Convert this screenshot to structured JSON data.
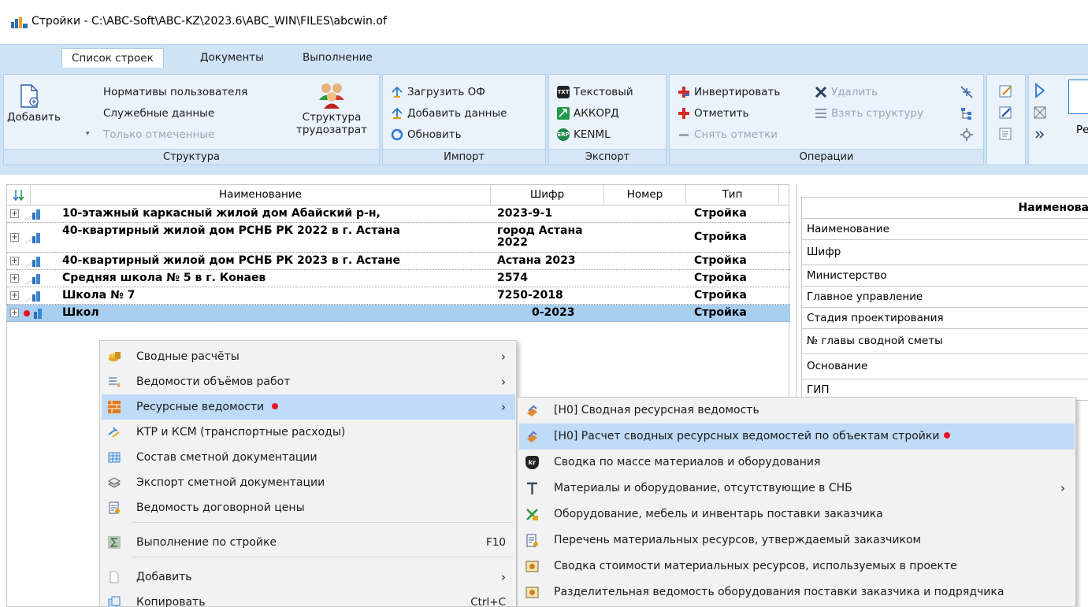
{
  "window": {
    "title": "Стройки - C:\\ABC-Soft\\ABC-KZ\\2023.6\\ABC_WIN\\FILES\\abcwin.of"
  },
  "tabs": [
    "Список строек",
    "Документы",
    "Выполнение"
  ],
  "ribbon": {
    "structure": {
      "caption": "Структура",
      "add": "Добавить",
      "user_norms": "Нормативы пользователя",
      "service_data": "Служебные данные",
      "only_marked": "Только отмеченные",
      "labor_line1": "Структура",
      "labor_line2": "трудозатрат"
    },
    "import": {
      "caption": "Импорт",
      "load_of": "Загрузить ОФ",
      "add_data": "Добавить данные",
      "refresh": "Обновить"
    },
    "export": {
      "caption": "Экспорт",
      "text": "Текстовый",
      "akkord": "АККОРД",
      "kenml": "KENML"
    },
    "operations": {
      "caption": "Операции",
      "invert": "Инвертировать",
      "delete": "Удалить",
      "mark": "Отметить",
      "take_structure": "Взять структуру",
      "unmark": "Снять отметки"
    },
    "partial": {
      "re": "Ре"
    }
  },
  "grid": {
    "columns": [
      "Наименование",
      "Шифр",
      "Номер",
      "Тип"
    ],
    "rows": [
      {
        "name": "10-этажный каркасный жилой дом Абайский р-н,",
        "code1": "2023-9-1",
        "code2": "",
        "number": "",
        "type": "Стройка"
      },
      {
        "name": "40-квартирный жилой дом РСНБ РК 2022 в г. Астана",
        "code1": "город Астана",
        "code2": "2022",
        "number": "",
        "type": "Стройка"
      },
      {
        "name": "40-квартирный жилой дом РСНБ РК 2023 в г. Астане",
        "code1": "Астана 2023",
        "code2": "",
        "number": "",
        "type": "Стройка"
      },
      {
        "name": "Средняя школа № 5 в г. Конаев",
        "code1": "2574",
        "code2": "",
        "number": "",
        "type": "Стройка"
      },
      {
        "name": "Школа № 7",
        "code1": "7250-2018",
        "code2": "",
        "number": "",
        "type": "Стройка"
      },
      {
        "name": "Школ",
        "code1": "0-2023",
        "code2": "",
        "number": "",
        "type": "Стройка"
      }
    ]
  },
  "panel": {
    "header": "Наименова",
    "fields": [
      "Наименование",
      "Шифр",
      "Министерство",
      "Главное управление",
      "Стадия проектирования",
      "№ главы сводной сметы",
      "Основание",
      "ГИП"
    ]
  },
  "context_menu": {
    "items": [
      {
        "label": "Сводные расчёты",
        "shortcut": "",
        "arrow": "›"
      },
      {
        "label": "Ведомости объёмов работ",
        "shortcut": "",
        "arrow": "›"
      },
      {
        "label": "Ресурсные ведомости",
        "shortcut": "",
        "arrow": "›"
      },
      {
        "label": "КТР и КСМ (транспортные расходы)",
        "shortcut": "",
        "arrow": ""
      },
      {
        "label": "Состав сметной документации",
        "shortcut": "",
        "arrow": ""
      },
      {
        "label": "Экспорт сметной документации",
        "shortcut": "",
        "arrow": ""
      },
      {
        "label": "Ведомость договорной цены",
        "shortcut": "",
        "arrow": ""
      },
      {
        "label": "Выполнение по стройке",
        "shortcut": "F10",
        "arrow": ""
      },
      {
        "label": "Добавить",
        "shortcut": "",
        "arrow": "›"
      },
      {
        "label": "Копировать",
        "shortcut": "Ctrl+C",
        "arrow": ""
      }
    ]
  },
  "submenu": {
    "items": [
      {
        "label": "[Н0] Сводная ресурсная ведомость",
        "arrow": ""
      },
      {
        "label": "[Н0] Расчет сводных ресурсных ведомостей по объектам стройки",
        "arrow": ""
      },
      {
        "label": "Сводка по массе материалов и оборудования",
        "arrow": ""
      },
      {
        "label": "Материалы и оборудование, отсутствующие в СНБ",
        "arrow": "›"
      },
      {
        "label": "Оборудование, мебель и инвентарь поставки заказчика",
        "arrow": ""
      },
      {
        "label": "Перечень материальных ресурсов, утверждаемый заказчиком",
        "arrow": ""
      },
      {
        "label": "Сводка стоимости материальных ресурсов, используемых в проекте",
        "arrow": ""
      },
      {
        "label": "Разделительная ведомость оборудования поставки заказчика и подрядчика",
        "arrow": ""
      }
    ]
  },
  "icons": {
    "txt_badge": "TXT",
    "erp_badge": "ERP",
    "kg_badge": "kг"
  },
  "colors": {
    "ribbon_bg": "#cfe3f7",
    "selection": "#a8cef0",
    "menu_highlight": "#bfdbf7",
    "marker_red": "#e81123"
  }
}
